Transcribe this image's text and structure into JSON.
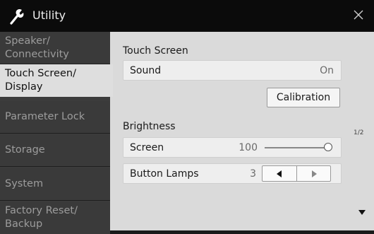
{
  "app": {
    "title": "Utility",
    "icon": "wrench-icon",
    "close_icon": "close-icon"
  },
  "sidebar": {
    "items": [
      {
        "label": "Speaker/\nConnectivity",
        "active": false
      },
      {
        "label": "Touch Screen/\nDisplay",
        "active": true
      },
      {
        "label": "Parameter Lock",
        "active": false
      },
      {
        "label": "Storage",
        "active": false
      },
      {
        "label": "System",
        "active": false
      },
      {
        "label": "Factory Reset/\nBackup",
        "active": false
      }
    ]
  },
  "touch_screen": {
    "section_title": "Touch Screen",
    "sound_label": "Sound",
    "sound_value": "On",
    "calibration_label": "Calibration"
  },
  "brightness": {
    "section_title": "Brightness",
    "screen_label": "Screen",
    "screen_value": "100",
    "screen_level": 1.0,
    "button_lamps_label": "Button Lamps",
    "button_lamps_value": "3"
  },
  "pager": {
    "indicator": "1/2"
  },
  "colors": {
    "title_bar": "#0b0b0b",
    "sidebar": "#3a3a3a",
    "sidebar_active": "#dedede",
    "content_bg": "#dadada",
    "row_bg": "#eeeeee"
  }
}
